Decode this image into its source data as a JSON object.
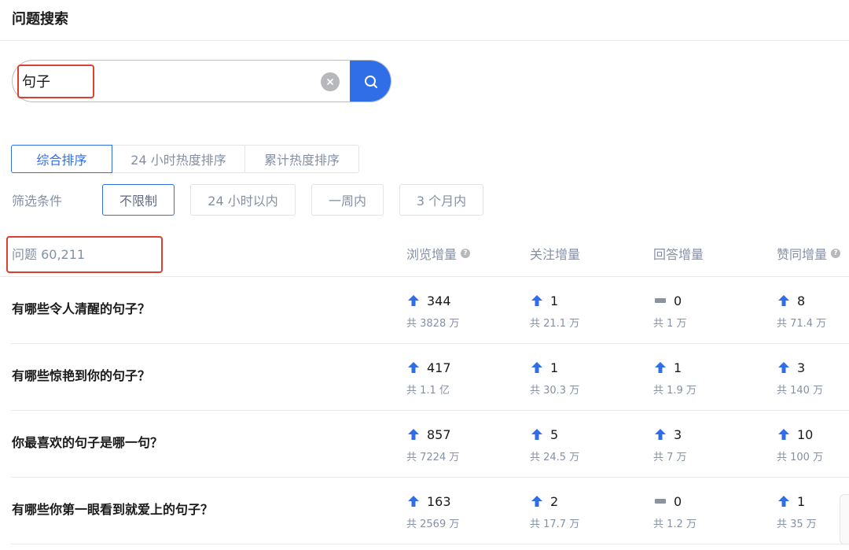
{
  "header": {
    "title": "问题搜索"
  },
  "search": {
    "value": "句子",
    "placeholder": ""
  },
  "sort_tabs": [
    {
      "label": "综合排序",
      "active": true
    },
    {
      "label": "24 小时热度排序",
      "active": false
    },
    {
      "label": "累计热度排序",
      "active": false
    }
  ],
  "filter": {
    "label": "筛选条件",
    "options": [
      {
        "label": "不限制",
        "active": true
      },
      {
        "label": "24 小时以内",
        "active": false
      },
      {
        "label": "一周内",
        "active": false
      },
      {
        "label": "3 个月内",
        "active": false
      }
    ]
  },
  "list": {
    "count_label": "问题 60,211",
    "columns": [
      "浏览增量",
      "关注增量",
      "回答增量",
      "赞同增量"
    ],
    "rows": [
      {
        "title": "有哪些令人清醒的句子？",
        "metrics": [
          {
            "trend": "up",
            "delta": "344",
            "total": "共 3828 万"
          },
          {
            "trend": "up",
            "delta": "1",
            "total": "共 21.1 万"
          },
          {
            "trend": "flat",
            "delta": "0",
            "total": "共 1 万"
          },
          {
            "trend": "up",
            "delta": "8",
            "total": "共 71.4 万"
          }
        ]
      },
      {
        "title": "有哪些惊艳到你的句子？",
        "metrics": [
          {
            "trend": "up",
            "delta": "417",
            "total": "共 1.1 亿"
          },
          {
            "trend": "up",
            "delta": "1",
            "total": "共 30.3 万"
          },
          {
            "trend": "up",
            "delta": "1",
            "total": "共 1.9 万"
          },
          {
            "trend": "up",
            "delta": "3",
            "total": "共 140 万"
          }
        ]
      },
      {
        "title": "你最喜欢的句子是哪一句？",
        "metrics": [
          {
            "trend": "up",
            "delta": "857",
            "total": "共 7224 万"
          },
          {
            "trend": "up",
            "delta": "5",
            "total": "共 24.5 万"
          },
          {
            "trend": "up",
            "delta": "3",
            "total": "共 7 万"
          },
          {
            "trend": "up",
            "delta": "10",
            "total": "共 100 万"
          }
        ]
      },
      {
        "title": "有哪些你第一眼看到就爱上的句子？",
        "metrics": [
          {
            "trend": "up",
            "delta": "163",
            "total": "共 2569 万"
          },
          {
            "trend": "up",
            "delta": "2",
            "total": "共 17.7 万"
          },
          {
            "trend": "flat",
            "delta": "0",
            "total": "共 1.2 万"
          },
          {
            "trend": "up",
            "delta": "1",
            "total": "共 35 万"
          }
        ]
      }
    ]
  },
  "colors": {
    "accent": "#2f6ee6",
    "highlight": "#d9412f",
    "muted": "#8590a6",
    "flat": "#8c93a0"
  },
  "icons": {
    "clear": "close-circle-icon",
    "search": "search-icon",
    "up": "arrow-up-icon",
    "flat": "dash-icon",
    "help": "question-icon"
  }
}
